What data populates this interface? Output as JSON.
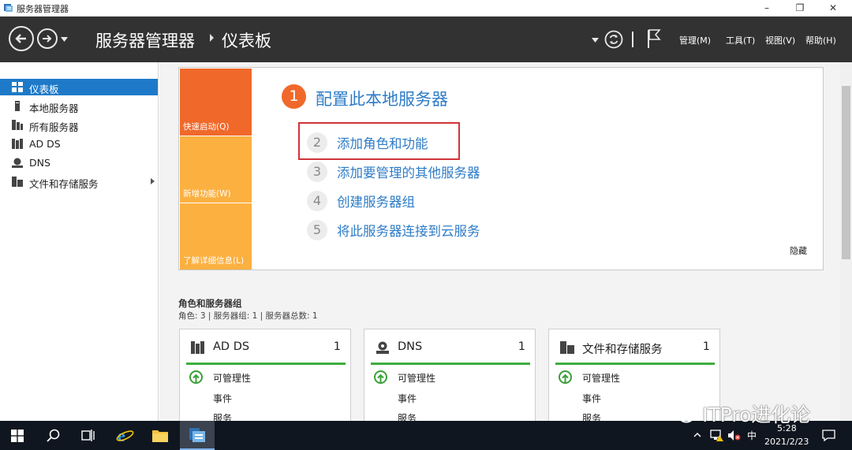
{
  "window": {
    "title": "服务器管理器",
    "buttons": {
      "minimize": "–",
      "maximize": "❐",
      "close": "✕"
    }
  },
  "header": {
    "breadcrumb_root": "服务器管理器",
    "breadcrumb_current": "仪表板",
    "menus": [
      "管理(M)",
      "工具(T)",
      "视图(V)",
      "帮助(H)"
    ]
  },
  "sidebar": {
    "items": [
      {
        "label": "仪表板",
        "icon": "dashboard-icon",
        "active": true
      },
      {
        "label": "本地服务器",
        "icon": "local-server-icon"
      },
      {
        "label": "所有服务器",
        "icon": "all-servers-icon"
      },
      {
        "label": "AD DS",
        "icon": "ad-ds-icon"
      },
      {
        "label": "DNS",
        "icon": "dns-icon"
      },
      {
        "label": "文件和存储服务",
        "icon": "file-storage-icon",
        "expandable": true
      }
    ]
  },
  "welcome": {
    "tiles": [
      "快速启动(Q)",
      "新增功能(W)",
      "了解详细信息(L)"
    ],
    "heading_num": "1",
    "heading": "配置此本地服务器",
    "steps": [
      {
        "num": "2",
        "label": "添加角色和功能",
        "highlighted": true
      },
      {
        "num": "3",
        "label": "添加要管理的其他服务器"
      },
      {
        "num": "4",
        "label": "创建服务器组"
      },
      {
        "num": "5",
        "label": "将此服务器连接到云服务"
      }
    ],
    "hide": "隐藏"
  },
  "roles": {
    "title": "角色和服务器组",
    "summary": "角色: 3 | 服务器组: 1 | 服务器总数: 1",
    "cards": [
      {
        "name": "AD DS",
        "count": "1",
        "icon": "ad-ds-icon",
        "rows": [
          "可管理性",
          "事件",
          "服务"
        ]
      },
      {
        "name": "DNS",
        "count": "1",
        "icon": "dns-icon",
        "rows": [
          "可管理性",
          "事件",
          "服务"
        ]
      },
      {
        "name": "文件和存储服务",
        "count": "1",
        "icon": "file-storage-icon",
        "rows": [
          "可管理性",
          "事件",
          "服务"
        ]
      }
    ]
  },
  "taskbar": {
    "ime": "中",
    "time": "5:28",
    "date": "2021/2/23"
  },
  "watermark": "ITPro进化论",
  "colors": {
    "header_bg": "#323232",
    "accent_blue": "#1e7ac8",
    "link_blue": "#2e7cc7",
    "orange_dark": "#f0692a",
    "orange_light": "#fbb040",
    "status_green": "#3fae3f",
    "highlight_red": "#d0343a"
  }
}
